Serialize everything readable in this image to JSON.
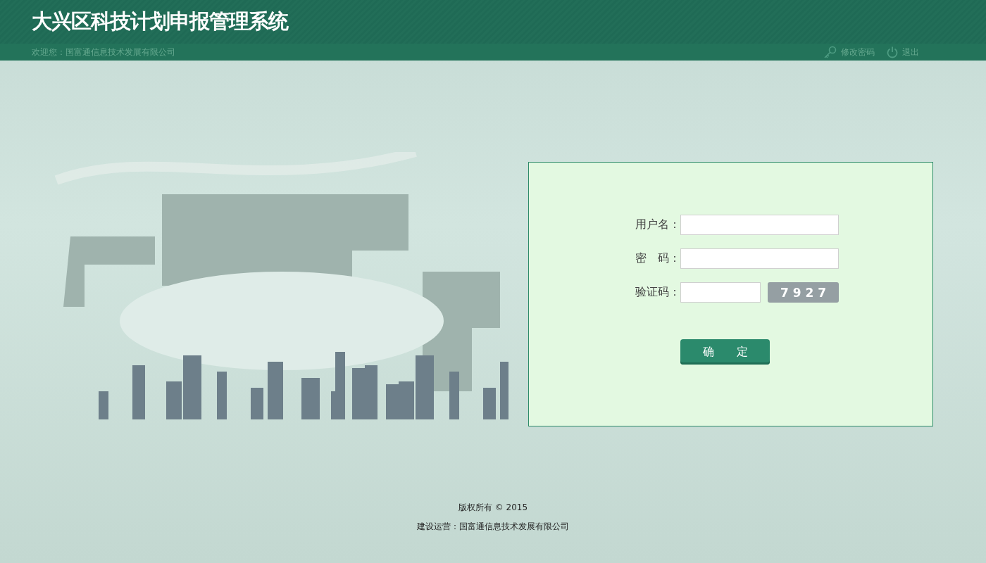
{
  "header": {
    "title": "大兴区科技计划申报管理系统",
    "welcome": "欢迎您：国富通信息技术发展有限公司",
    "links": [
      {
        "kind": "key",
        "label": "修改密码"
      },
      {
        "kind": "power",
        "label": "退出"
      }
    ]
  },
  "login": {
    "fields": [
      {
        "kind": "text",
        "label": "用户名："
      },
      {
        "kind": "password",
        "label": "密　码："
      },
      {
        "kind": "captcha",
        "label": "验证码：",
        "code": "7 9 2 7"
      }
    ],
    "submit": "确　　定"
  },
  "footer": {
    "copyright": "版权所有 © 2015",
    "operator": "建设运营：国富通信息技术发展有限公司"
  }
}
